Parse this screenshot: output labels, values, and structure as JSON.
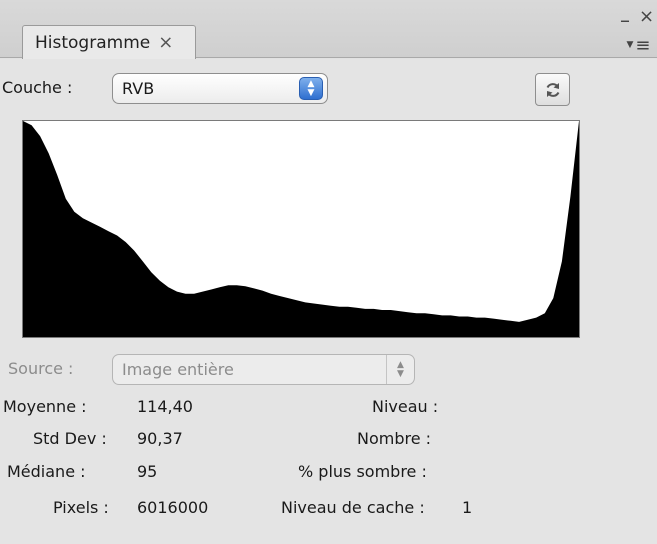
{
  "tab": {
    "title": "Histogramme",
    "close_glyph": "×"
  },
  "window": {
    "minimize_glyph": "–",
    "close_glyph": "×",
    "menu_glyph": "≡"
  },
  "channel": {
    "label": "Couche :",
    "value": "RVB"
  },
  "source": {
    "label": "Source :",
    "value": "Image entière"
  },
  "stats": {
    "mean": {
      "label": "Moyenne :",
      "value": "114,40"
    },
    "stddev": {
      "label": "Std Dev :",
      "value": "90,37"
    },
    "median": {
      "label": "Médiane :",
      "value": "95"
    },
    "pixels": {
      "label": "Pixels :",
      "value": "6016000"
    },
    "level": {
      "label": "Niveau :",
      "value": ""
    },
    "count": {
      "label": "Nombre :",
      "value": ""
    },
    "percentile": {
      "label": "% plus sombre :",
      "value": ""
    },
    "cache_level": {
      "label": "Niveau de cache :",
      "value": "1"
    }
  },
  "histogram": {
    "bins": [
      1.0,
      0.98,
      0.93,
      0.85,
      0.75,
      0.64,
      0.58,
      0.55,
      0.53,
      0.51,
      0.49,
      0.47,
      0.44,
      0.4,
      0.35,
      0.3,
      0.26,
      0.23,
      0.21,
      0.2,
      0.2,
      0.21,
      0.22,
      0.23,
      0.24,
      0.24,
      0.235,
      0.225,
      0.215,
      0.2,
      0.19,
      0.18,
      0.17,
      0.16,
      0.155,
      0.15,
      0.145,
      0.14,
      0.14,
      0.135,
      0.13,
      0.13,
      0.125,
      0.125,
      0.12,
      0.115,
      0.11,
      0.11,
      0.105,
      0.1,
      0.1,
      0.095,
      0.095,
      0.09,
      0.09,
      0.085,
      0.08,
      0.075,
      0.07,
      0.08,
      0.09,
      0.11,
      0.18,
      0.35,
      0.65,
      1.0
    ]
  }
}
